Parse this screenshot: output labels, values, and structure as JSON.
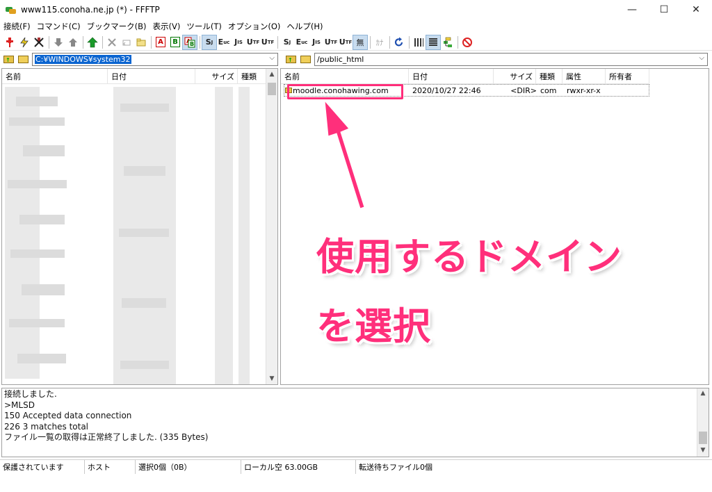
{
  "window": {
    "title": "www115.conoha.ne.jp (*) - FFFTP",
    "minimize_glyph": "—",
    "maximize_glyph": "☐",
    "close_glyph": "✕"
  },
  "menu": [
    "接続(F)",
    "コマンド(C)",
    "ブックマーク(B)",
    "表示(V)",
    "ツール(T)",
    "オプション(O)",
    "ヘルプ(H)"
  ],
  "toolbar": {
    "ascii_label": "A",
    "binary_label": "B",
    "auto_label": "A",
    "sjis_label": "S",
    "euc_label": "E",
    "jis_label": "J",
    "utf8_label": "U",
    "utf8bom_label": "U",
    "none_label": "無",
    "kana_label": "ｶﾅ"
  },
  "local": {
    "path": "C:¥WINDOWS¥system32",
    "columns": {
      "name": "名前",
      "date": "日付",
      "size": "サイズ",
      "type": "種類"
    }
  },
  "remote": {
    "path": "/public_html",
    "columns": {
      "name": "名前",
      "date": "日付",
      "size": "サイズ",
      "type": "種類",
      "attr": "属性",
      "owner": "所有者"
    },
    "files": [
      {
        "name": "moodle.conohawing.com",
        "date": "2020/10/27 22:46",
        "size": "<DIR>",
        "type": "com",
        "attr": "rwxr-xr-x",
        "owner": ""
      }
    ]
  },
  "log_lines": [
    "接続しました.",
    ">MLSD",
    "150 Accepted data connection",
    "226 3 matches total",
    "ファイル一覧の取得は正常終了しました. (335 Bytes)"
  ],
  "status": {
    "protection": "保護されています",
    "host": "ホスト",
    "selection": "選択0個（0B）",
    "local_free": "ローカル空 63.00GB",
    "queue": "転送待ちファイル0個"
  },
  "annotation": {
    "line1": "使用するドメイン",
    "line2": "を選択",
    "color": "#ff2f7b"
  }
}
